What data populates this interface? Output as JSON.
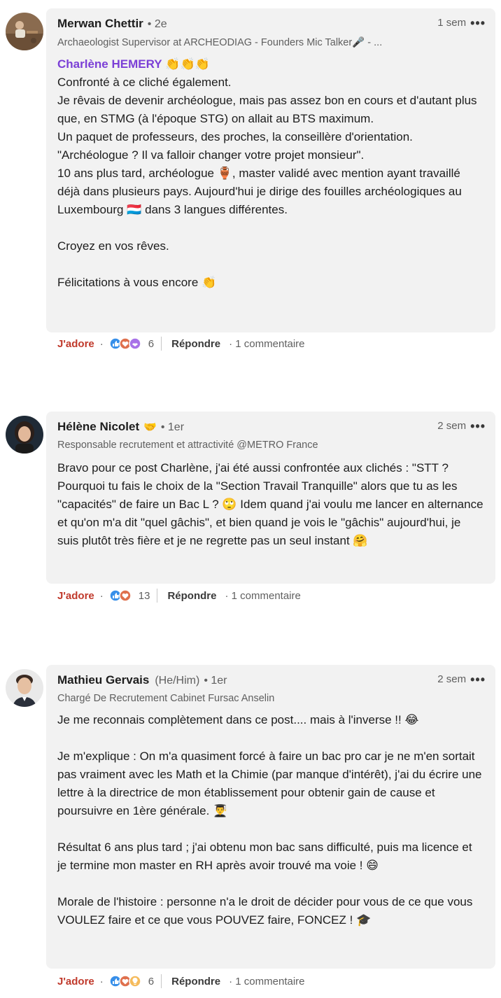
{
  "comments": [
    {
      "author": "Merwan Chettir",
      "pronoun": "",
      "degree": "• 2e",
      "time": "1 sem",
      "more": "•••",
      "headline": "Archaeologist Supervisor at ARCHEODIAG - Founders Mic Talker🎤 - ...",
      "mention": "Charlène HEMERY",
      "mention_emoji": "👏👏👏",
      "body": "Confronté à ce cliché également.\nJe rêvais de devenir archéologue, mais pas assez bon en cours et d'autant plus que, en STMG (à l'époque STG) on allait au BTS maximum.\nUn paquet de professeurs, des proches, la conseillère d'orientation. \"Archéologue ? Il va falloir changer votre projet monsieur\".\n10 ans plus tard, archéologue 🏺, master validé avec mention ayant travaillé déjà dans plusieurs pays. Aujourd'hui je dirige des fouilles archéologiques au Luxembourg 🇱🇺 dans 3 langues différentes.\n\nCroyez en vos rêves.\n\nFélicitations à vous encore 👏",
      "like_label": "J'adore",
      "dot": "·",
      "reaction_count": "6",
      "reply_label": "Répondre",
      "reply_count": "· 1 commentaire"
    },
    {
      "author": "Hélène Nicolet",
      "author_emoji": "🤝",
      "pronoun": "",
      "degree": "• 1er",
      "time": "2 sem",
      "more": "•••",
      "headline": "Responsable recrutement et attractivité @METRO France",
      "body": "Bravo pour ce post Charlène, j'ai été aussi confrontée aux clichés : \"STT ? Pourquoi tu fais le choix de la \"Section Travail Tranquille\" alors que tu as les \"capacités\" de faire un Bac L ? 🙄 Idem quand j'ai voulu me lancer en alternance et qu'on m'a dit \"quel gâchis\", et bien quand je vois le \"gâchis\" aujourd'hui, je suis plutôt très fière et je ne regrette pas un seul instant 🤗",
      "like_label": "J'adore",
      "dot": "·",
      "reaction_count": "13",
      "reply_label": "Répondre",
      "reply_count": "· 1 commentaire"
    },
    {
      "author": "Mathieu Gervais",
      "pronoun": "(He/Him)",
      "degree": "• 1er",
      "time": "2 sem",
      "more": "•••",
      "headline": "Chargé De Recrutement Cabinet Fursac Anselin",
      "body": "Je me reconnais complètement dans ce post.... mais à l'inverse !! 😂\n\nJe m'explique : On m'a quasiment forcé à faire un bac pro car je ne m'en sortait pas vraiment avec les Math et la Chimie (par manque d'intérêt), j'ai du écrire une lettre à la directrice de mon établissement pour obtenir gain de cause et poursuivre en 1ère générale. 👨‍🎓\n\nRésultat 6 ans plus tard ; j'ai obtenu mon bac sans difficulté, puis ma licence et je termine mon master en RH après avoir trouvé ma voie ! 😄\n\nMorale de l'histoire : personne n'a le droit de décider pour vous de ce que vous VOULEZ faire et ce que vous POUVEZ faire, FONCEZ ! 🎓",
      "like_label": "J'adore",
      "dot": "·",
      "reaction_count": "6",
      "reply_label": "Répondre",
      "reply_count": "· 1 commentaire"
    }
  ],
  "colors": {
    "bubble_bg": "#f2f2f2",
    "like_red": "#c0392b",
    "mention_purple": "#7b3fd6",
    "secondary_text": "#5f5f5f"
  }
}
